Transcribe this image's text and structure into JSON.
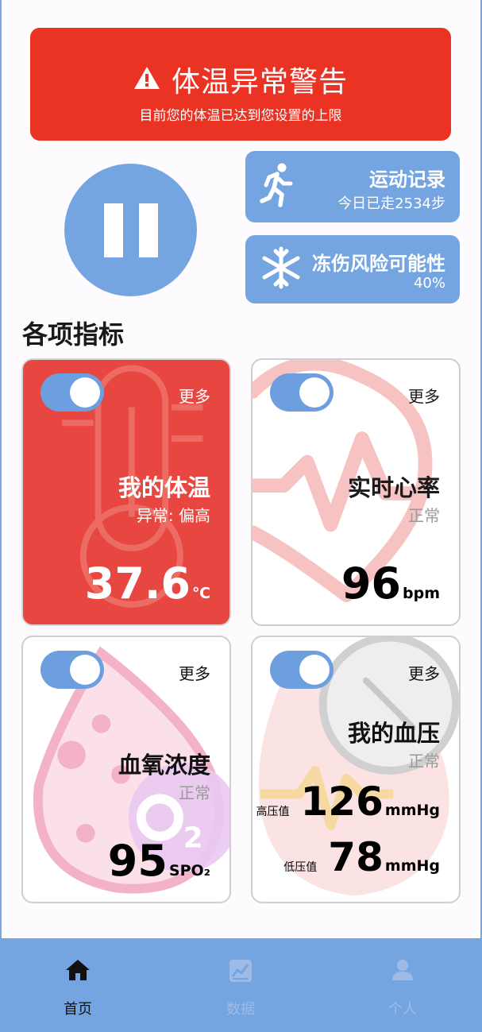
{
  "alert": {
    "title": "体温异常警告",
    "subtitle": "目前您的体温已达到您设置的上限",
    "icon": "warning-icon",
    "color": "#ea3323"
  },
  "pause_button": {
    "icon": "pause-icon"
  },
  "exercise": {
    "title": "运动记录",
    "subtitle": "今日已走2534步",
    "icon": "running-icon"
  },
  "frostbite": {
    "title": "冻伤风险可能性",
    "subtitle": "40%",
    "icon": "snowflake-icon"
  },
  "section_title": "各项指标",
  "metrics": {
    "temperature": {
      "more": "更多",
      "title": "我的体温",
      "status": "异常: 偏高",
      "value": "37.6",
      "unit": "℃",
      "enabled": true,
      "icon": "thermometer-icon"
    },
    "heart": {
      "more": "更多",
      "title": "实时心率",
      "status": "正常",
      "value": "96",
      "unit": "bpm",
      "enabled": true,
      "icon": "heart-icon"
    },
    "oxygen": {
      "more": "更多",
      "title": "血氧浓度",
      "status": "正常",
      "value": "95",
      "unit": "SPO₂",
      "enabled": true,
      "icon": "blood-drop-icon"
    },
    "bp": {
      "more": "更多",
      "title": "我的血压",
      "status": "正常",
      "high_label": "高压值",
      "high_value": "126",
      "high_unit": "mmHg",
      "low_label": "低压值",
      "low_value": "78",
      "low_unit": "mmHg",
      "enabled": true,
      "icon": "blood-pressure-icon"
    }
  },
  "nav": {
    "items": [
      {
        "label": "首页",
        "icon": "home-icon",
        "active": true
      },
      {
        "label": "数据",
        "icon": "chart-icon",
        "active": false
      },
      {
        "label": "个人",
        "icon": "user-icon",
        "active": false
      }
    ]
  },
  "colors": {
    "accent": "#75a5e1",
    "danger": "#e84640",
    "toggle": "#6c9ee0"
  }
}
